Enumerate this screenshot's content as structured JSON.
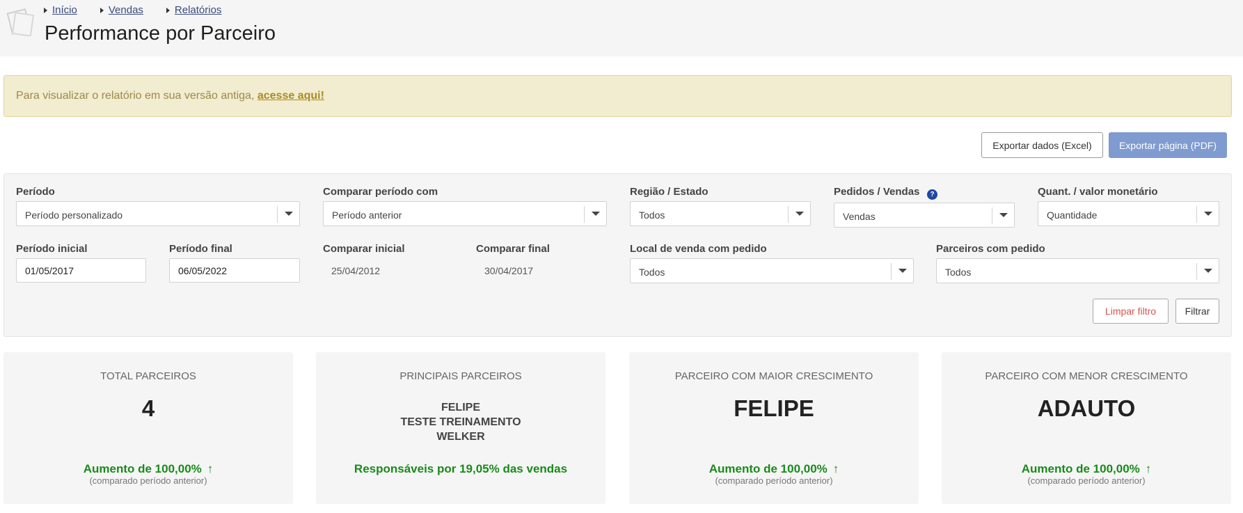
{
  "breadcrumb": [
    {
      "label": "Início"
    },
    {
      "label": "Vendas"
    },
    {
      "label": "Relatórios"
    }
  ],
  "page_title": "Performance por Parceiro",
  "notice": {
    "text": "Para visualizar o relatório em sua versão antiga, ",
    "link": "acesse aqui!"
  },
  "toolbar": {
    "export_excel": "Exportar dados (Excel)",
    "export_pdf": "Exportar página (PDF)"
  },
  "filters": {
    "periodo": {
      "label": "Período",
      "value": "Período personalizado"
    },
    "comparar": {
      "label": "Comparar período com",
      "value": "Período anterior"
    },
    "regiao": {
      "label": "Região / Estado",
      "value": "Todos"
    },
    "pedidos": {
      "label": "Pedidos / Vendas",
      "value": "Vendas",
      "help": "?"
    },
    "quant": {
      "label": "Quant. / valor monetário",
      "value": "Quantidade"
    },
    "periodo_inicial": {
      "label": "Período inicial",
      "value": "01/05/2017"
    },
    "periodo_final": {
      "label": "Período final",
      "value": "06/05/2022"
    },
    "comparar_inicial": {
      "label": "Comparar inicial",
      "value": "25/04/2012"
    },
    "comparar_final": {
      "label": "Comparar final",
      "value": "30/04/2017"
    },
    "local_venda": {
      "label": "Local de venda com pedido",
      "value": "Todos"
    },
    "parceiros": {
      "label": "Parceiros com pedido",
      "value": "Todos"
    },
    "clear_label": "Limpar filtro",
    "filter_label": "Filtrar"
  },
  "cards": {
    "total": {
      "title": "TOTAL PARCEIROS",
      "value": "4",
      "stat": "Aumento de 100,00%",
      "sub": "(comparado período anterior)"
    },
    "principais": {
      "title": "PRINCIPAIS PARCEIROS",
      "items": [
        "FELIPE",
        "TESTE TREINAMENTO",
        "WELKER"
      ],
      "stat": "Responsáveis por 19,05% das vendas"
    },
    "maior": {
      "title": "PARCEIRO COM MAIOR CRESCIMENTO",
      "value": "FELIPE",
      "stat": "Aumento de 100,00%",
      "sub": "(comparado período anterior)"
    },
    "menor": {
      "title": "PARCEIRO COM MENOR CRESCIMENTO",
      "value": "ADAUTO",
      "stat": "Aumento de 100,00%",
      "sub": "(comparado período anterior)"
    }
  },
  "icons": {
    "logo": "report-logo-icon",
    "breadcrumb_caret": "caret-right-icon",
    "select_arrow": "chevron-down-icon",
    "trend": "arrow-up-icon"
  },
  "colors": {
    "link": "#3a4a80",
    "notice_bg": "#f2ecd0",
    "pdf_button": "#7f9bd0",
    "positive": "#1a8a1a",
    "clear_text": "#d9534f",
    "help_badge": "#1f47a3"
  }
}
